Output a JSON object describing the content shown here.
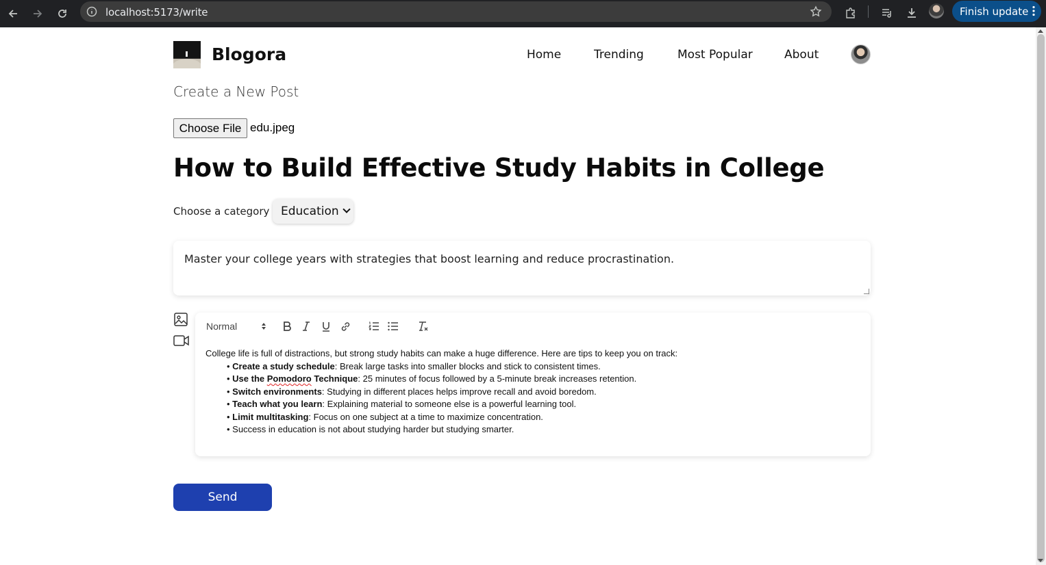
{
  "browser": {
    "url": "localhost:5173/write",
    "update_label": "Finish update"
  },
  "header": {
    "brand": "Blogora",
    "nav": [
      "Home",
      "Trending",
      "Most Popular",
      "About"
    ]
  },
  "page": {
    "subtitle": "Create a New Post",
    "file_button": "Choose File",
    "file_name": "edu.jpeg",
    "title": "How to Build Effective Study Habits in College",
    "category_label": "Choose a category",
    "category_value": "Education",
    "description": "Master your college years with strategies that boost learning and reduce procrastination.",
    "send_label": "Send"
  },
  "editor": {
    "format": "Normal",
    "intro": "College life is full of distractions, but strong study habits can make a huge difference. Here are tips to keep you on track:",
    "items": [
      {
        "bold": "Create a study schedule",
        "text": ": Break large tasks into smaller blocks and stick to consistent times."
      },
      {
        "bold_pre": "Use the ",
        "bold_mid": "Pomodoro",
        "bold_post": " Technique",
        "text": ": 25 minutes of focus followed by a 5-minute break increases retention."
      },
      {
        "bold": "Switch environments",
        "text": ": Studying in different places helps improve recall and avoid boredom."
      },
      {
        "bold": "Teach what you learn",
        "text": ": Explaining material to someone else is a powerful learning tool."
      },
      {
        "bold": "Limit multitasking",
        "text": ": Focus on one subject at a time to maximize concentration."
      },
      {
        "bold": "",
        "text": " Success in education is not about studying harder but studying smarter."
      }
    ]
  }
}
